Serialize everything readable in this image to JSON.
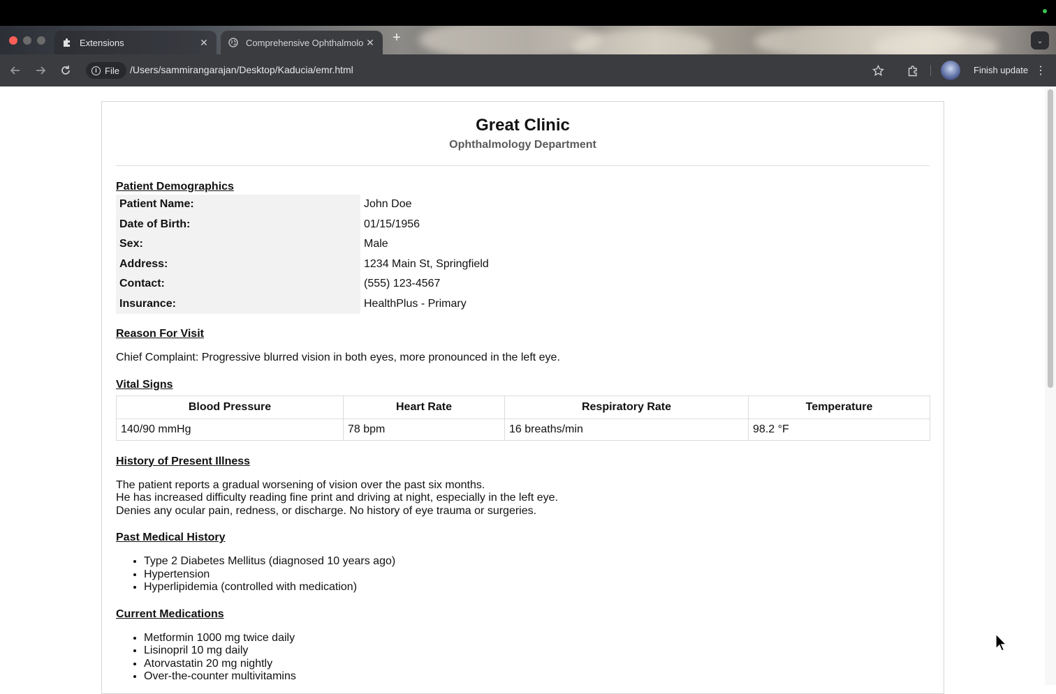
{
  "browser": {
    "tabs": [
      {
        "title": "Extensions",
        "active": false,
        "icon": "puzzle-icon"
      },
      {
        "title": "Comprehensive Ophthalmolo",
        "active": true,
        "icon": "globe-icon"
      }
    ],
    "new_tab_symbol": "+",
    "address": {
      "scheme_chip": "File",
      "url": "/Users/sammirangarajan/Desktop/Kaducia/emr.html"
    },
    "finish_update_label": "Finish update"
  },
  "document": {
    "clinic_name": "Great Clinic",
    "department": "Ophthalmology Department",
    "demographics": {
      "title": "Patient Demographics",
      "rows": [
        {
          "label": "Patient Name:",
          "value": "John Doe"
        },
        {
          "label": "Date of Birth:",
          "value": "01/15/1956"
        },
        {
          "label": "Sex:",
          "value": "Male"
        },
        {
          "label": "Address:",
          "value": "1234 Main St, Springfield"
        },
        {
          "label": "Contact:",
          "value": "(555) 123-4567"
        },
        {
          "label": "Insurance:",
          "value": "HealthPlus - Primary"
        }
      ]
    },
    "reason": {
      "title": "Reason For Visit",
      "text": "Chief Complaint: Progressive blurred vision in both eyes, more pronounced in the left eye."
    },
    "vitals": {
      "title": "Vital Signs",
      "headers": [
        "Blood Pressure",
        "Heart Rate",
        "Respiratory Rate",
        "Temperature"
      ],
      "values": [
        "140/90 mmHg",
        "78 bpm",
        "16 breaths/min",
        "98.2 °F"
      ]
    },
    "hpi": {
      "title": "History of Present Illness",
      "lines": [
        "The patient reports a gradual worsening of vision over the past six months.",
        "He has increased difficulty reading fine print and driving at night, especially in the left eye.",
        "Denies any ocular pain, redness, or discharge. No history of eye trauma or surgeries."
      ]
    },
    "pmh": {
      "title": "Past Medical History",
      "items": [
        "Type 2 Diabetes Mellitus (diagnosed 10 years ago)",
        "Hypertension",
        "Hyperlipidemia (controlled with medication)"
      ]
    },
    "meds": {
      "title": "Current Medications",
      "items": [
        "Metformin 1000 mg twice daily",
        "Lisinopril 10 mg daily",
        "Atorvastatin 20 mg nightly",
        "Over-the-counter multivitamins"
      ]
    }
  }
}
